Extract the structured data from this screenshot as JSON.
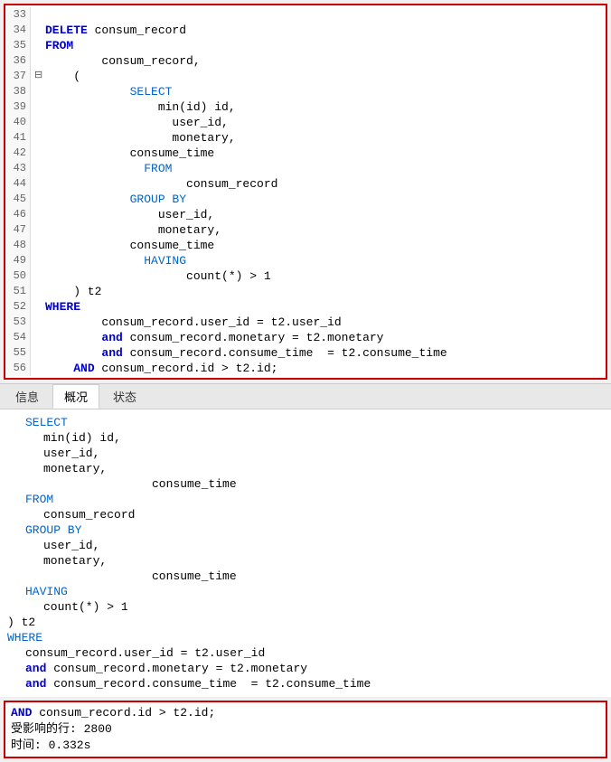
{
  "topPanel": {
    "lines": [
      {
        "num": "33",
        "indent": 0,
        "content": ""
      },
      {
        "num": "34",
        "keyword": "DELETE",
        "rest": " consum_record",
        "type": "delete_line"
      },
      {
        "num": "35",
        "keyword": "FROM",
        "rest": "",
        "type": "keyword_line"
      },
      {
        "num": "36",
        "indent": 8,
        "content": "consum_record,",
        "type": "plain"
      },
      {
        "num": "37",
        "fold": true,
        "indent": 4,
        "content": "    (",
        "type": "fold_line"
      },
      {
        "num": "38",
        "keyword": "SELECT",
        "indent": 12,
        "type": "keyword_indent"
      },
      {
        "num": "39",
        "indent": 16,
        "content": "min(id) id,",
        "type": "plain"
      },
      {
        "num": "40",
        "indent": 16,
        "content": "user_id,",
        "type": "plain"
      },
      {
        "num": "41",
        "indent": 16,
        "content": "monetary,",
        "type": "plain"
      },
      {
        "num": "42",
        "indent": 12,
        "content": "consume_time",
        "type": "plain"
      },
      {
        "num": "43",
        "keyword": "FROM",
        "indent": 12,
        "type": "keyword_indent"
      },
      {
        "num": "44",
        "indent": 16,
        "content": "consum_record",
        "type": "plain"
      },
      {
        "num": "45",
        "keyword": "GROUP BY",
        "indent": 12,
        "type": "keyword_indent"
      },
      {
        "num": "46",
        "indent": 16,
        "content": "user_id,",
        "type": "plain"
      },
      {
        "num": "47",
        "indent": 16,
        "content": "monetary,",
        "type": "plain"
      },
      {
        "num": "48",
        "indent": 12,
        "content": "consume_time",
        "type": "plain"
      },
      {
        "num": "49",
        "keyword": "HAVING",
        "indent": 12,
        "type": "keyword_indent"
      },
      {
        "num": "50",
        "indent": 20,
        "content": "count(*) > 1",
        "type": "plain"
      },
      {
        "num": "51",
        "indent": 4,
        "content": "  ) t2",
        "type": "plain"
      },
      {
        "num": "52",
        "keyword": "WHERE",
        "indent": 0,
        "type": "keyword_line"
      },
      {
        "num": "53",
        "indent": 8,
        "content": "consum_record.user_id = t2.user_id",
        "type": "plain"
      },
      {
        "num": "54",
        "keyword_inline": "and",
        "indent": 8,
        "content": " consum_record.monetary = t2.monetary",
        "type": "and_line"
      },
      {
        "num": "55",
        "keyword_inline": "and",
        "indent": 8,
        "content": " consum_record.consume_time  = t2.consume_time",
        "type": "and_line"
      },
      {
        "num": "56",
        "keyword_inline": "AND",
        "indent": 0,
        "content": " consum_record.id > t2.id;",
        "type": "and_line"
      }
    ]
  },
  "tabs": {
    "items": [
      {
        "label": "信息",
        "active": false
      },
      {
        "label": "概况",
        "active": true
      },
      {
        "label": "状态",
        "active": false
      }
    ]
  },
  "bottomPanel": {
    "lines": [
      {
        "indent": 4,
        "keyword": "SELECT",
        "rest": ""
      },
      {
        "indent": 8,
        "text": "min(id) id,"
      },
      {
        "indent": 8,
        "text": "user_id,"
      },
      {
        "indent": 8,
        "text": "monetary,"
      },
      {
        "indent": 160,
        "text": "consume_time"
      },
      {
        "indent": 4,
        "keyword": "FROM",
        "rest": ""
      },
      {
        "indent": 8,
        "text": "consum_record"
      },
      {
        "indent": 4,
        "keyword": "GROUP BY",
        "rest": ""
      },
      {
        "indent": 8,
        "text": "user_id,"
      },
      {
        "indent": 8,
        "text": "monetary,"
      },
      {
        "indent": 160,
        "text": "consume_time"
      },
      {
        "indent": 4,
        "keyword": "HAVING",
        "rest": ""
      },
      {
        "indent": 8,
        "text": "count(*) > 1"
      },
      {
        "indent": 0,
        "text": ") t2"
      },
      {
        "indent": 0,
        "keyword": "WHERE",
        "rest": ""
      },
      {
        "indent": 4,
        "text": "consum_record.user_id = t2.user_id"
      },
      {
        "indent": 4,
        "kw_inline": "and",
        "text": " consum_record.monetary = t2.monetary"
      },
      {
        "indent": 4,
        "kw_inline": "and",
        "text": " consum_record.consume_time  = t2.consume_time"
      }
    ]
  },
  "resultBox": {
    "lines": [
      "AND consum_record.id > t2.id;",
      "受影响的行: 2800",
      "时间: 0.332s"
    ]
  }
}
